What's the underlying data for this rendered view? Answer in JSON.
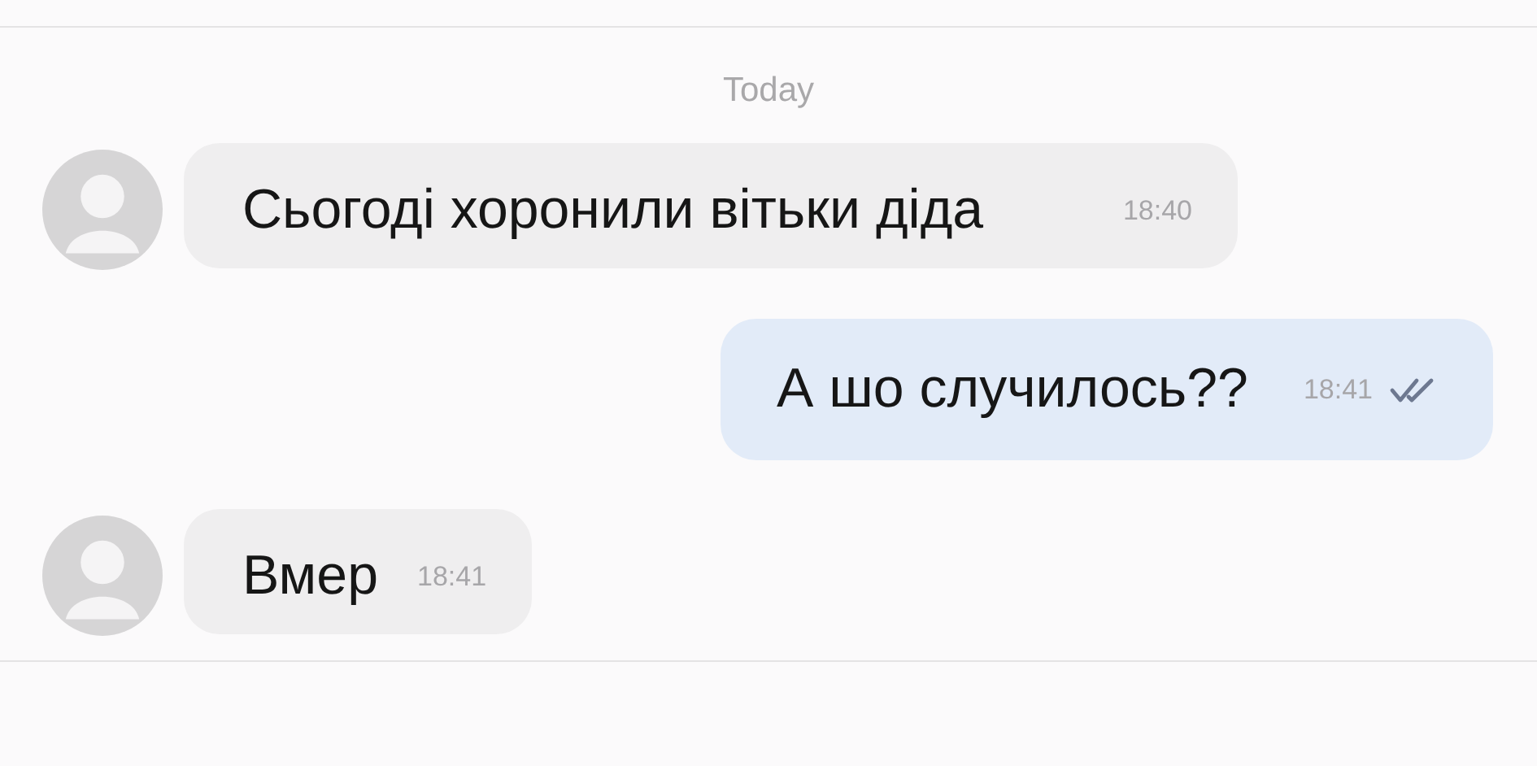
{
  "date_label": "Today",
  "messages": [
    {
      "kind": "incoming",
      "text": "Сьогоді хоронили вітьки діда",
      "time": "18:40"
    },
    {
      "kind": "outgoing",
      "text": "А шо случилось??",
      "time": "18:41",
      "read": true
    },
    {
      "kind": "incoming",
      "text": "Вмер",
      "time": "18:41"
    }
  ]
}
